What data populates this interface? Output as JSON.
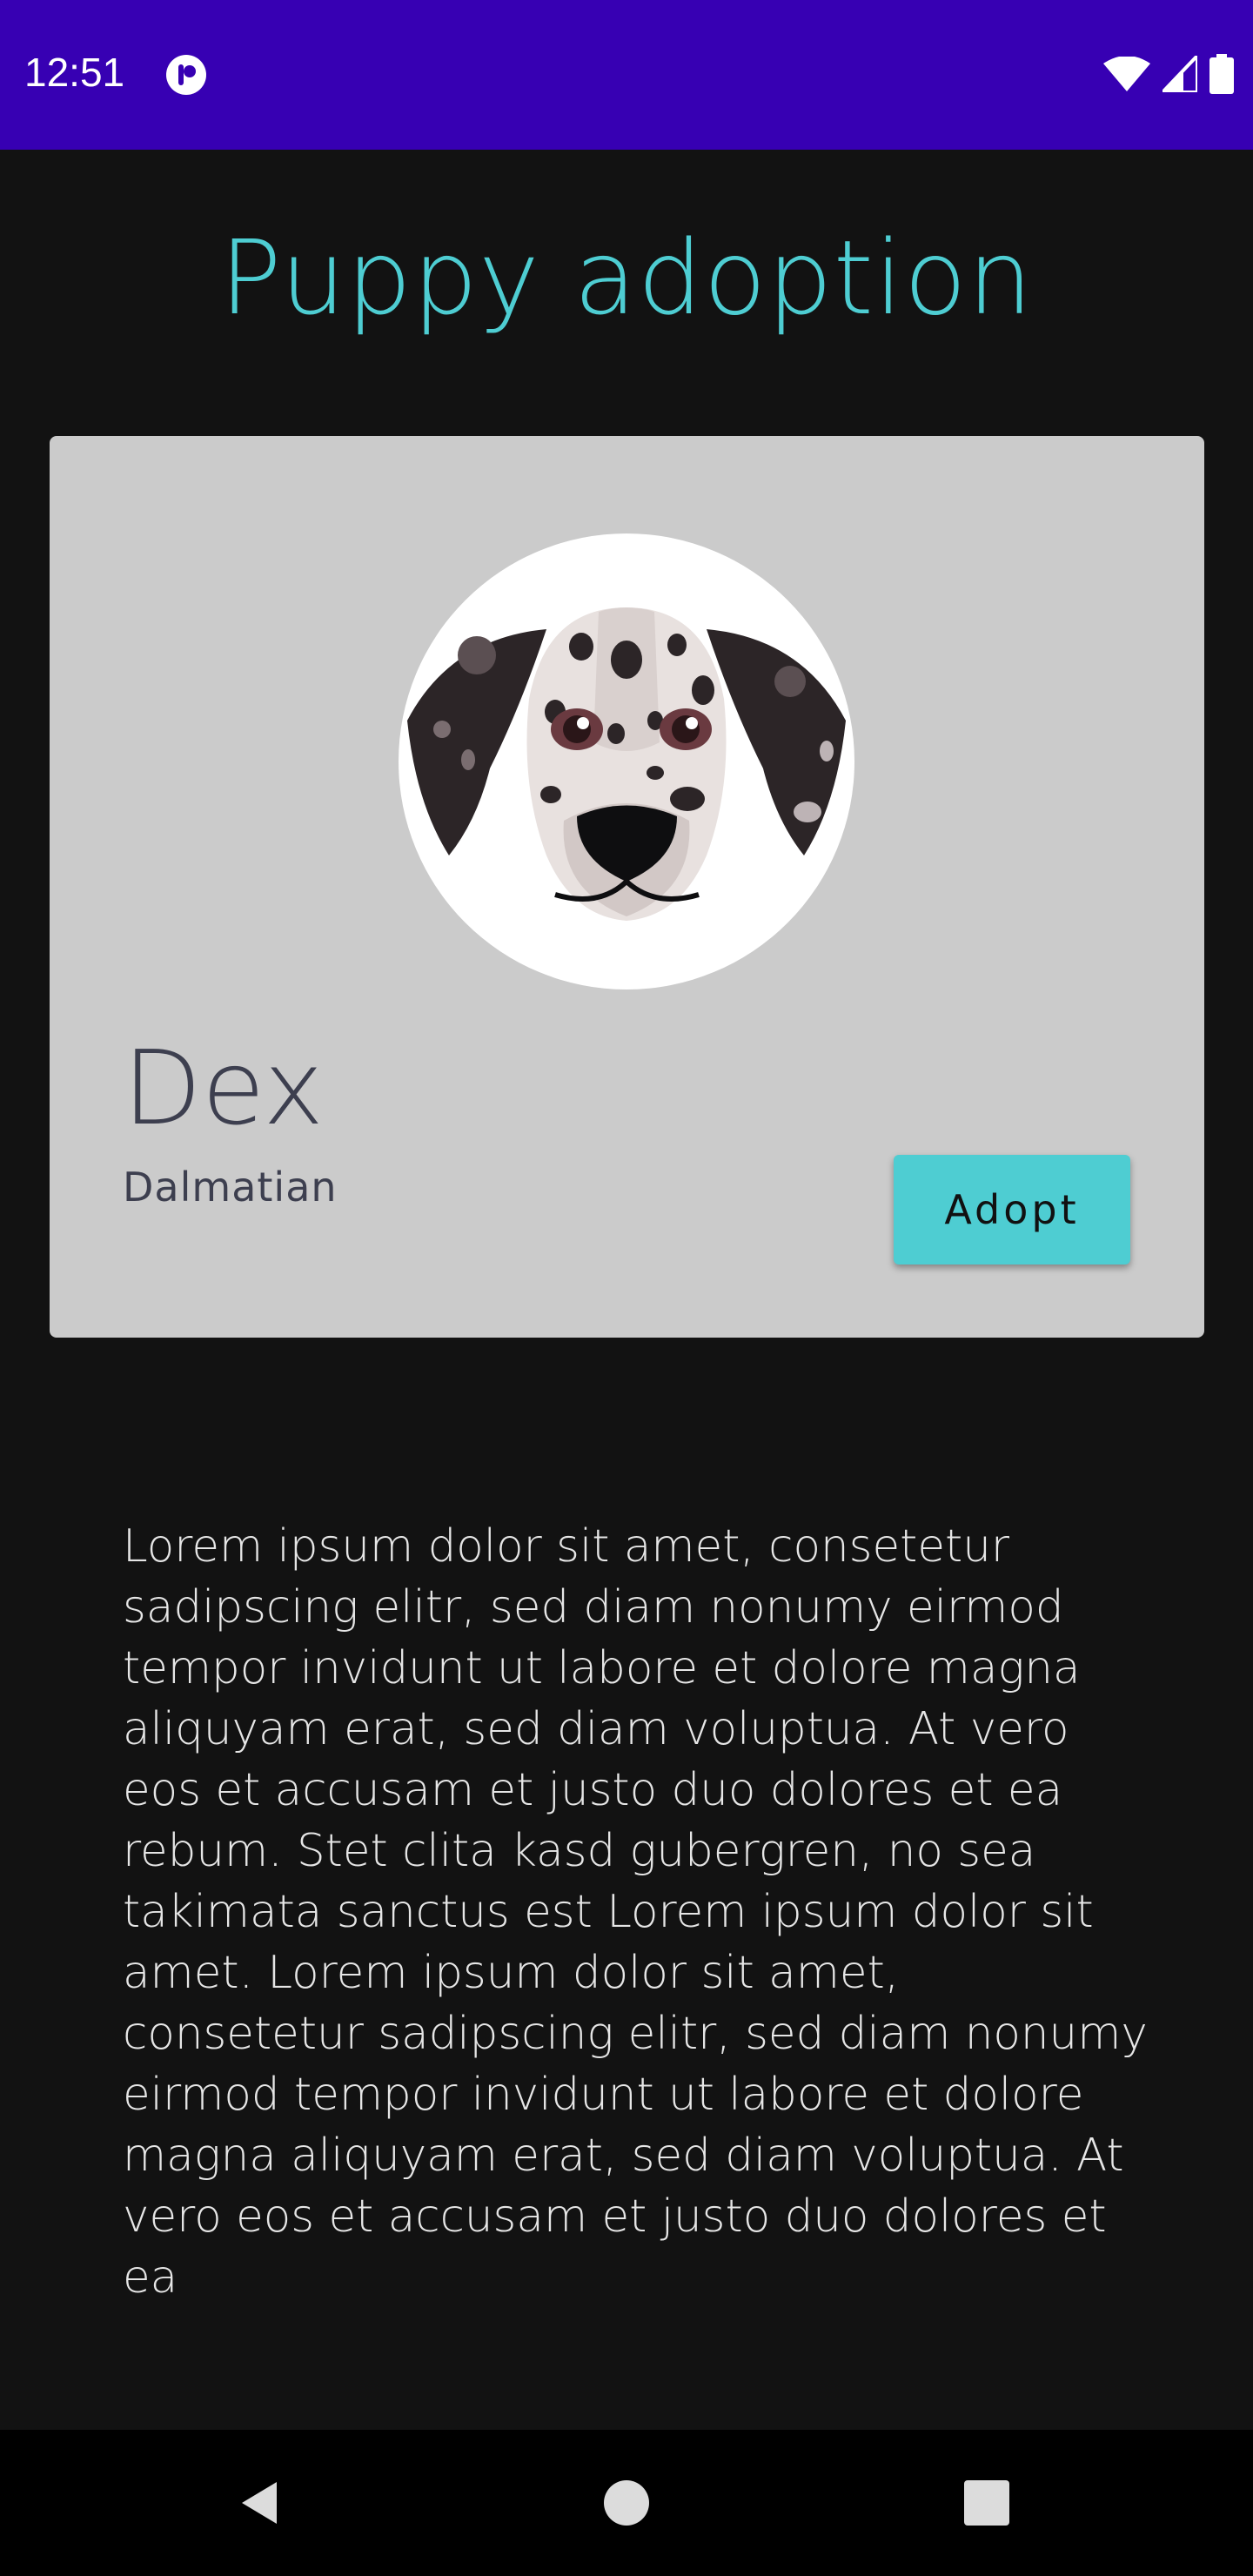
{
  "status_bar": {
    "time": "12:51",
    "icons": [
      "app-notification-icon",
      "wifi-icon",
      "cellular-signal-icon",
      "battery-icon"
    ]
  },
  "header": {
    "title": "Puppy adoption"
  },
  "puppy_card": {
    "avatar_icon": "dalmatian-face",
    "name": "Dex",
    "breed": "Dalmatian",
    "adopt_label": "Adopt"
  },
  "description": "Lorem ipsum dolor sit amet, consetetur sadipscing elitr, sed diam nonumy eirmod tempor invidunt ut labore et dolore magna aliquyam erat, sed diam voluptua. At vero eos et accusam et justo duo dolores et ea rebum. Stet clita kasd gubergren, no sea takimata sanctus est Lorem ipsum dolor sit amet. Lorem ipsum dolor sit amet, consetetur sadipscing elitr, sed diam nonumy eirmod tempor invidunt ut labore et dolore magna aliquyam erat, sed diam voluptua. At vero eos et accusam et justo duo dolores et ea",
  "nav_bar": {
    "buttons": [
      "back-icon",
      "home-icon",
      "recents-icon"
    ]
  },
  "colors": {
    "status_bar": "#3700b3",
    "background": "#121212",
    "accent": "#4ecdd2",
    "card": "#cbcbcb",
    "card_text": "#3d3f4f",
    "nav_bar": "#000000"
  }
}
